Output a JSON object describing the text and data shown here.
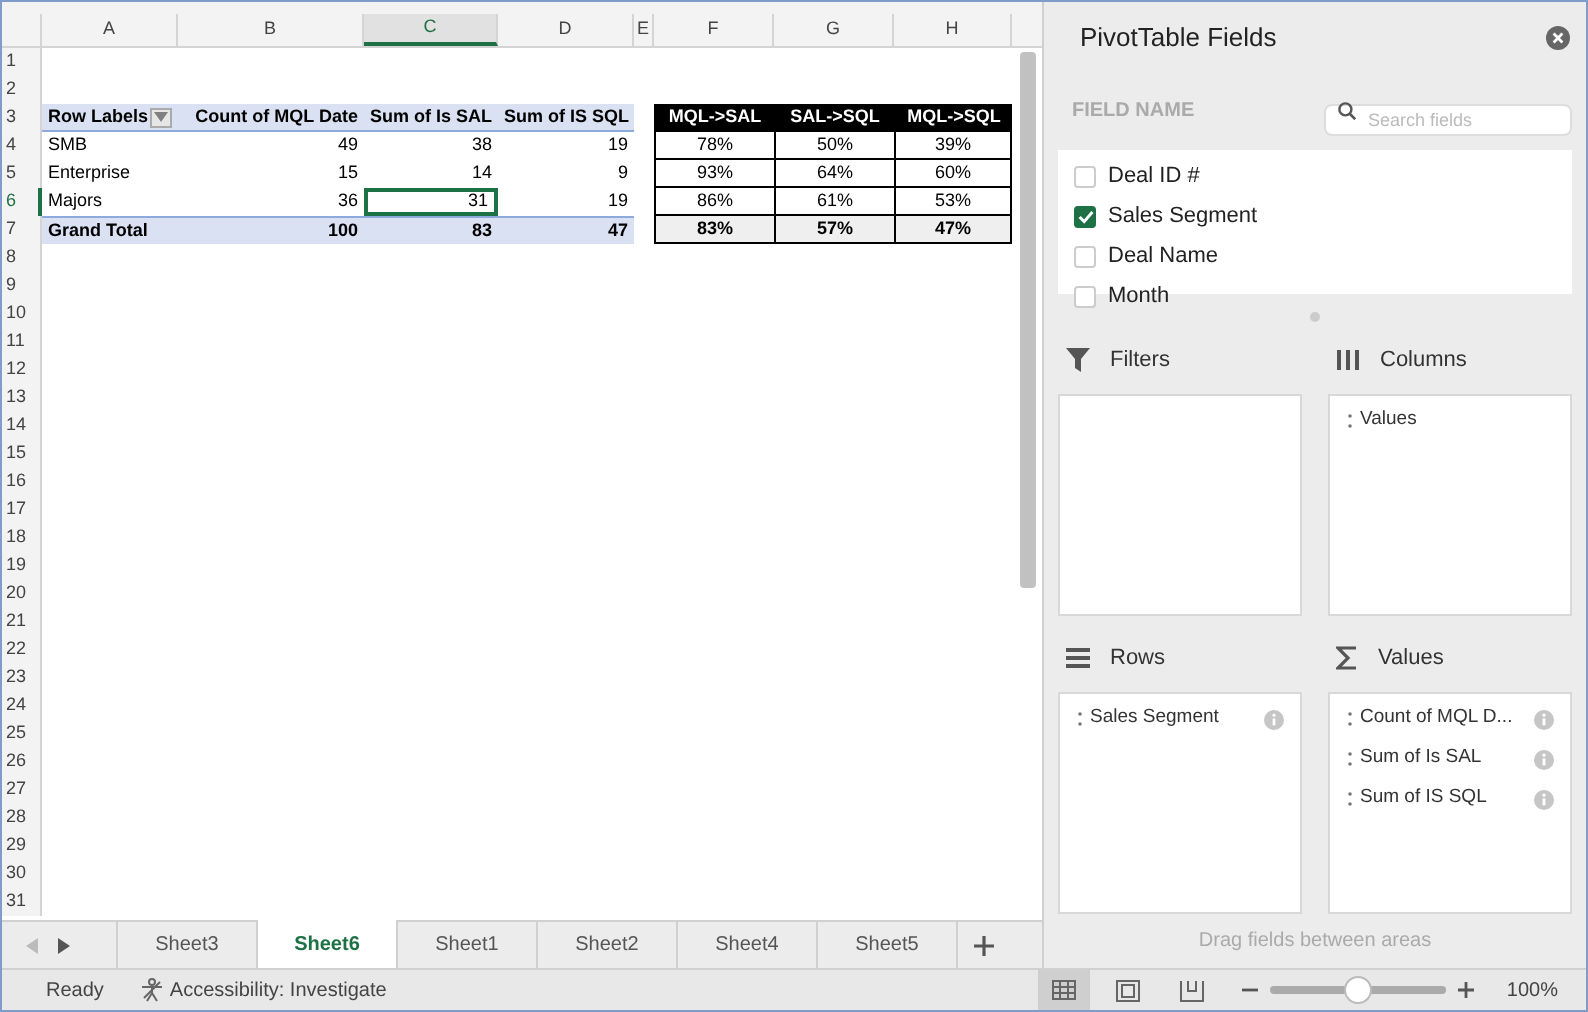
{
  "columns": [
    {
      "label": "A",
      "selected": false
    },
    {
      "label": "B",
      "selected": false
    },
    {
      "label": "C",
      "selected": true
    },
    {
      "label": "D",
      "selected": false
    },
    {
      "label": "E",
      "selected": false
    },
    {
      "label": "F",
      "selected": false
    },
    {
      "label": "G",
      "selected": false
    },
    {
      "label": "H",
      "selected": false
    }
  ],
  "row_numbers": [
    {
      "label": "1",
      "selected": false
    },
    {
      "label": "2",
      "selected": false
    },
    {
      "label": "3",
      "selected": false
    },
    {
      "label": "4",
      "selected": false
    },
    {
      "label": "5",
      "selected": false
    },
    {
      "label": "6",
      "selected": true
    },
    {
      "label": "7",
      "selected": false
    },
    {
      "label": "8",
      "selected": false
    },
    {
      "label": "9",
      "selected": false
    },
    {
      "label": "10",
      "selected": false
    },
    {
      "label": "11",
      "selected": false
    },
    {
      "label": "12",
      "selected": false
    },
    {
      "label": "13",
      "selected": false
    },
    {
      "label": "14",
      "selected": false
    },
    {
      "label": "15",
      "selected": false
    },
    {
      "label": "16",
      "selected": false
    },
    {
      "label": "17",
      "selected": false
    },
    {
      "label": "18",
      "selected": false
    },
    {
      "label": "19",
      "selected": false
    },
    {
      "label": "20",
      "selected": false
    },
    {
      "label": "21",
      "selected": false
    },
    {
      "label": "22",
      "selected": false
    },
    {
      "label": "23",
      "selected": false
    },
    {
      "label": "24",
      "selected": false
    },
    {
      "label": "25",
      "selected": false
    },
    {
      "label": "26",
      "selected": false
    },
    {
      "label": "27",
      "selected": false
    },
    {
      "label": "28",
      "selected": false
    },
    {
      "label": "29",
      "selected": false
    },
    {
      "label": "30",
      "selected": false
    },
    {
      "label": "31",
      "selected": false
    }
  ],
  "pivot": {
    "headers": [
      "Row Labels",
      "Count of MQL Date",
      "Sum of Is SAL",
      "Sum of IS SQL"
    ],
    "rows": [
      {
        "label": "SMB",
        "cells": [
          {
            "text": "49",
            "selected": false
          },
          {
            "text": "38",
            "selected": false
          },
          {
            "text": "19",
            "selected": false
          }
        ]
      },
      {
        "label": "Enterprise",
        "cells": [
          {
            "text": "15",
            "selected": false
          },
          {
            "text": "14",
            "selected": false
          },
          {
            "text": "9",
            "selected": false
          }
        ]
      },
      {
        "label": "Majors",
        "cells": [
          {
            "text": "36",
            "selected": false
          },
          {
            "text": "31",
            "selected": true
          },
          {
            "text": "19",
            "selected": false
          }
        ]
      }
    ],
    "total": {
      "label": "Grand Total",
      "cells": [
        "100",
        "83",
        "47"
      ]
    }
  },
  "ratios": {
    "headers": [
      "MQL->SAL",
      "SAL->SQL",
      "MQL->SQL"
    ],
    "rows": [
      [
        "78%",
        "50%",
        "39%"
      ],
      [
        "93%",
        "64%",
        "60%"
      ],
      [
        "86%",
        "61%",
        "53%"
      ]
    ],
    "total": [
      "83%",
      "57%",
      "47%"
    ]
  },
  "sheet_tabs": [
    {
      "label": "Sheet3",
      "selected": false
    },
    {
      "label": "Sheet6",
      "selected": true
    },
    {
      "label": "Sheet1",
      "selected": false
    },
    {
      "label": "Sheet2",
      "selected": false
    },
    {
      "label": "Sheet4",
      "selected": false
    },
    {
      "label": "Sheet5",
      "selected": false
    }
  ],
  "status_bar": {
    "ready": "Ready",
    "accessibility": "Accessibility: Investigate",
    "views": [
      {
        "kind": "normal",
        "selected": true
      },
      {
        "kind": "page_layout",
        "selected": false
      },
      {
        "kind": "page_break",
        "selected": false
      }
    ],
    "zoom_slider": {
      "level": 0.49
    },
    "zoom": "100%"
  },
  "pivot_panel": {
    "title": "PivotTable Fields",
    "field_name": "FIELD NAME",
    "search": {
      "placeholder": "Search fields"
    },
    "fields": [
      {
        "label": "Deal ID #",
        "checked": false
      },
      {
        "label": "Sales Segment",
        "checked": true
      },
      {
        "label": "Deal Name",
        "checked": false
      },
      {
        "label": "Month",
        "checked": false
      }
    ],
    "areas": [
      {
        "kind": "filters",
        "label": "Filters"
      },
      {
        "kind": "columns",
        "label": "Columns",
        "items": [
          {
            "label": "Values",
            "info": false
          }
        ]
      },
      {
        "kind": "rows",
        "label": "Rows",
        "items": [
          {
            "label": "Sales Segment",
            "info": true
          }
        ]
      },
      {
        "kind": "values",
        "label": "Values",
        "items": [
          {
            "label": "Count of MQL D...",
            "info": true
          },
          {
            "label": "Sum of Is SAL",
            "info": true
          },
          {
            "label": "Sum of IS SQL",
            "info": true
          }
        ]
      }
    ],
    "hint": "Drag fields between areas"
  }
}
